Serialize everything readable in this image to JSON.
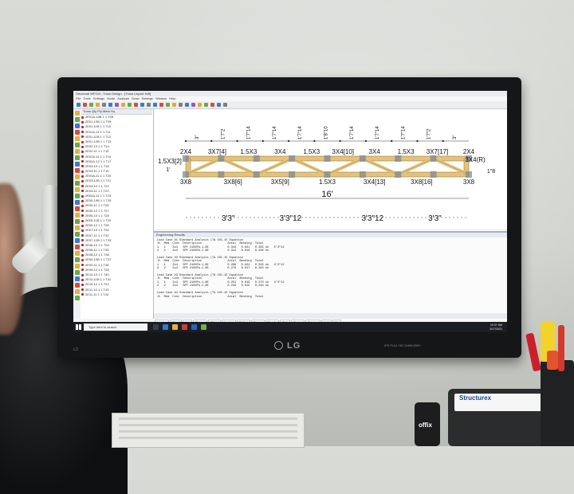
{
  "screen": {
    "title_bar": "Structural WFCM  -  Truss Design  -  [Truss Layout 16ft]",
    "menu": [
      "File",
      "Tools",
      "Settings",
      "Mode",
      "Analysis",
      "Draw",
      "Settings",
      "Window",
      "Help"
    ],
    "left_panel": {
      "header": [
        "Truss",
        "Qty",
        "Ply",
        "Mark",
        "Sq"
      ],
      "rows": [
        "2E01A-10B  1  1  T08",
        "2E01-10B  1  1  T09",
        "2E01-11B  1  1  T10",
        "2E01A-11  1  1  T11",
        "2E01-11B  1  1  T12",
        "2E01-12B  1  1  T13",
        "2E02-10  1  1  T14",
        "2E02-11  1  1  T15",
        "2E02A-11  1  1  T16",
        "2E02A-12  1  1  T17",
        "2E03-10  1  1  T18",
        "2E03-11  1  1  T19",
        "2E03A-11  1  1  T20",
        "2E03-12B  1  1  T21",
        "2E04-10  1  1  T22",
        "2E04-11  1  1  T23",
        "2E04A-11  1  1  T24",
        "2E05-10B  1  1  T25",
        "2E05-11  1  1  T26",
        "2E05-12  1  1  T27",
        "2E06-10  1  1  T28",
        "2E06-11B  1  1  T29",
        "2E06-12  1  1  T30",
        "2E07-10  1  1  T31",
        "2E07-11  1  1  T32",
        "2E07-12B  1  1  T33",
        "2E08-10  1  1  T34",
        "2E08-11  1  1  T35",
        "2E08-12  1  1  T36",
        "2E09-10B  1  1  T37",
        "2E09-11  1  1  T38",
        "2E09-12  1  1  T39",
        "2E10-10  1  1  T40",
        "2E10-11B  1  1  T41",
        "2E10-12  1  1  T42",
        "2E11-10  1  1  T43",
        "2E11-11  1  1  T44"
      ]
    },
    "truss": {
      "top_dims": [
        "3\"",
        "1'7\"2",
        "1'7\"14",
        "1'7\"14",
        "1'7\"14",
        "1'8\"10",
        "1'7\"14",
        "1'7\"14",
        "1'7\"14",
        "1'7\"2",
        "3\""
      ],
      "plates_top": [
        "2X4",
        "3X7[4]",
        "1.5X3",
        "3X4",
        "1.5X3",
        "3X4[10]",
        "3X4",
        "1.5X3",
        "3X7[17]",
        "2X4"
      ],
      "plates_bottom": [
        "3X8",
        "3X8[6]",
        "3X5[9]",
        "1.5X3",
        "3X4[13]",
        "3X8[16]",
        "3X8"
      ],
      "left_label": "1.5X3[2]",
      "right_label": "3X4(R)",
      "left_height": "1'",
      "right_height": "1\"8",
      "span": "16'",
      "bottom_dims": [
        "3'3\"",
        "3'3\"12",
        "3'3\"12",
        "3'3\""
      ]
    },
    "engineering": {
      "title": "Engineering Results",
      "lines": [
        "Load Case #1 Standard Analysis (TA 10C-15 Equation",
        "Jt  Mem  Cont  Description               Axial  Bending  Total",
        "1   1    3x4   SPF 2100Fb-1.8E           0.344   0.021   0.365 ok   5'3\"12",
        "2   2    3x4   SPF 2100Fb-1.8E           0.312   0.018   0.330 ok",
        "",
        "Load Case #2 Standard Analysis (TA 10C-15 Equation",
        "Jt  Mem  Cont  Description               Axial  Bending  Total",
        "1   1    3x4   SPF 2100Fb-1.8E           0.298   0.022   0.320 ok   4'3\"12",
        "3   2    3x4   SPF 2100Fb-1.8E           0.276   0.017   0.293 ok",
        "",
        "Load Case #3 Standard Analysis (TA 10C-15 Equation",
        "Jt  Mem  Cont  Description               Axial  Bending  Total",
        "1   1    3x4   SPF 2100Fb-1.8E           0.251   0.019   0.270 ok   3'3\"12",
        "2   2    3x4   SPF 2100Fb-1.8E           0.233   0.015   0.248 ok",
        "",
        "Load Case #4 Standard Analysis (TA 10C-15 Equation",
        "Jt  Mem  Cont  Description               Axial  Bending  Total"
      ]
    },
    "tabs": [
      "Loading",
      "Dead",
      "Live",
      "Bearing",
      "Plates",
      "Lumber",
      "Deflect",
      "Forces",
      "Results",
      "Print",
      "Design",
      "Trusses",
      "Jack",
      "Hip"
    ],
    "taskbar": {
      "search_placeholder": "Type here to search",
      "time": "10:37 AM",
      "date": "3/17/2021"
    }
  },
  "monitor": {
    "brand": "LG",
    "left_logo": "LD",
    "model": "IPS FULL HD  24MK430H"
  },
  "desk": {
    "phone_label": "offix",
    "device_label": "Structurex"
  },
  "colors": {
    "lumber": "#e4c27a",
    "plate": "#7f8a96",
    "node_red": "#b3262d",
    "accent_blue": "#2f5ea8"
  }
}
